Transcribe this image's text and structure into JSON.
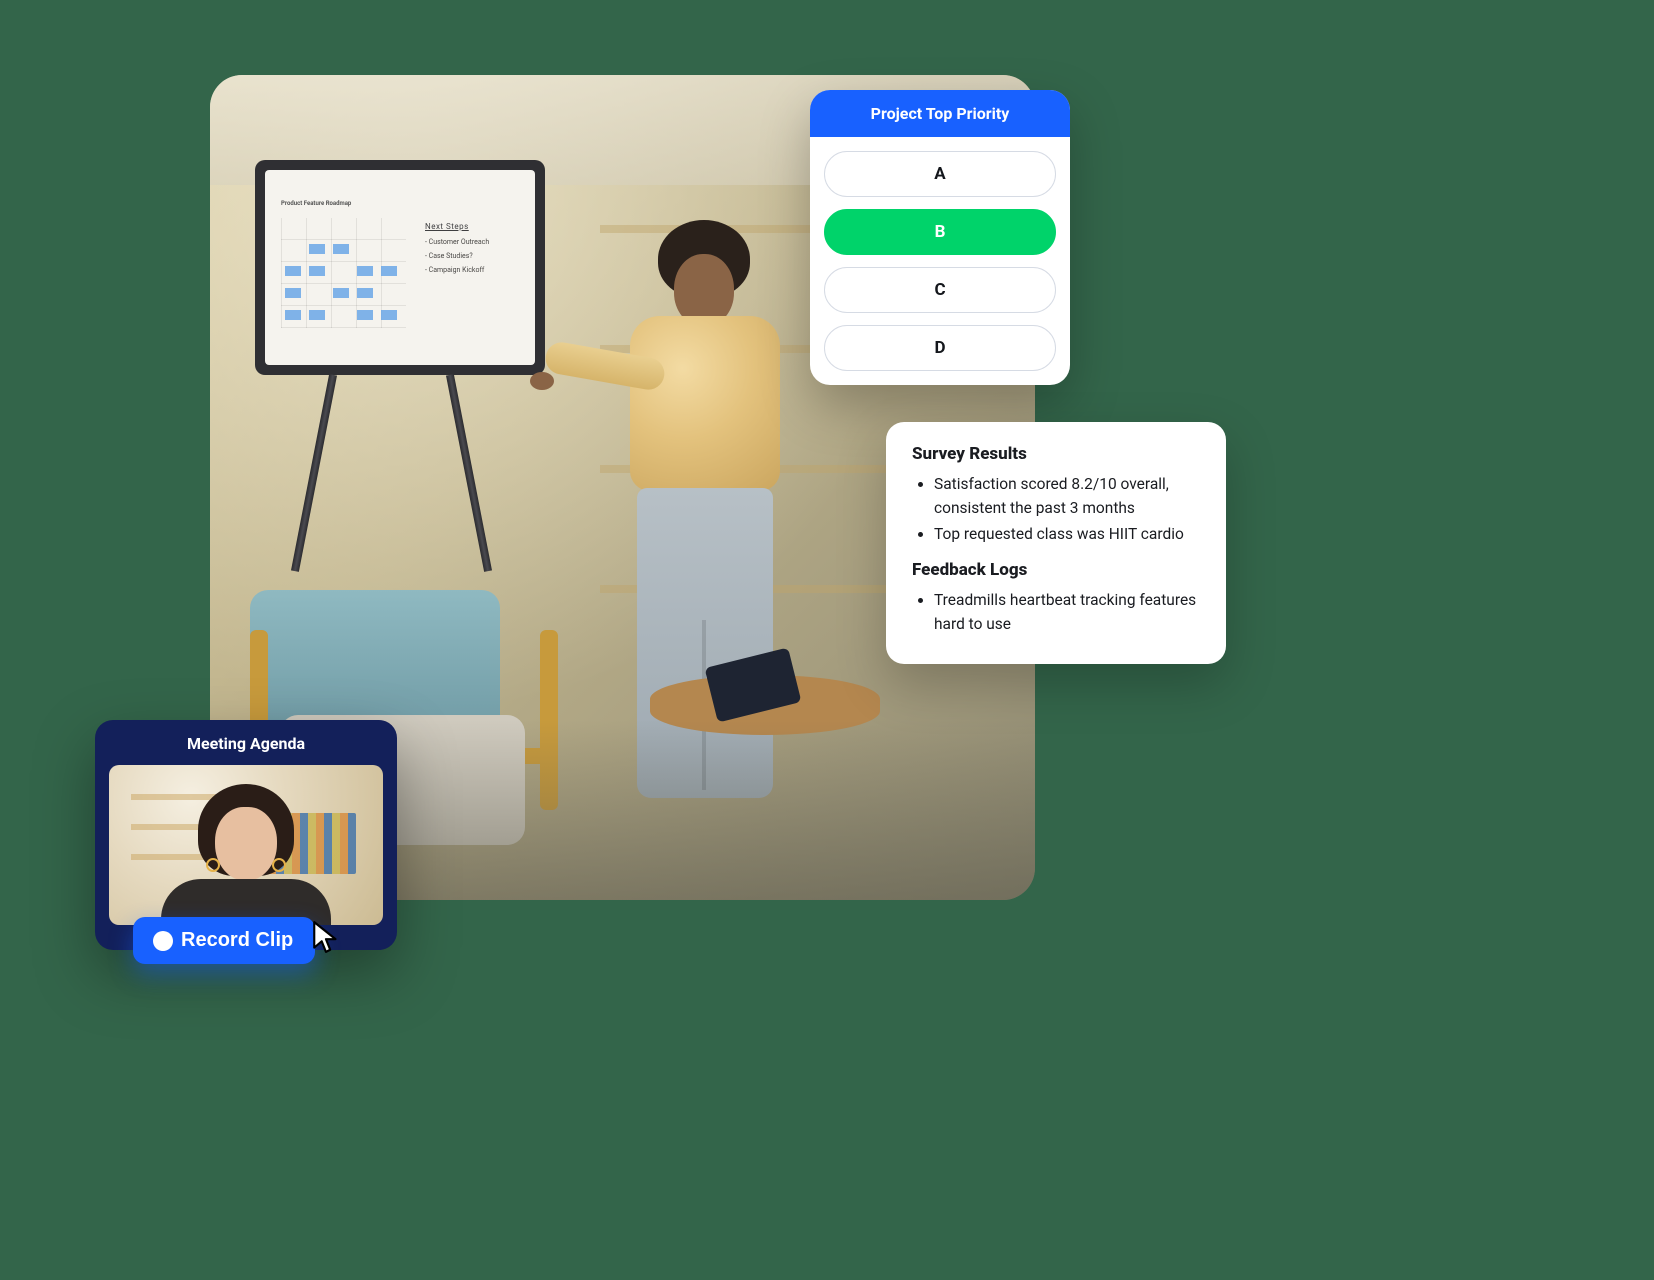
{
  "poll": {
    "title": "Project Top Priority",
    "options": [
      "A",
      "B",
      "C",
      "D"
    ],
    "selected_index": 1
  },
  "survey_card": {
    "heading1": "Survey Results",
    "bullets1": [
      "Satisfaction scored 8.2/10 overall, consistent the past 3 months",
      "Top requested class was HIIT cardio"
    ],
    "heading2": "Feedback Logs",
    "bullets2": [
      "Treadmills heartbeat tracking features hard to use"
    ]
  },
  "agenda": {
    "title": "Meeting Agenda",
    "record_label": "Record Clip"
  },
  "whiteboard": {
    "roadmap_title": "Product Feature Roadmap",
    "notes_title": "Next Steps",
    "notes": [
      "- Customer Outreach",
      "- Case Studies?",
      "- Campaign Kickoff"
    ]
  },
  "colors": {
    "brand_blue": "#1861ff",
    "select_green": "#00d36a",
    "panel_navy": "#13205a",
    "page_bg": "#33654a"
  }
}
